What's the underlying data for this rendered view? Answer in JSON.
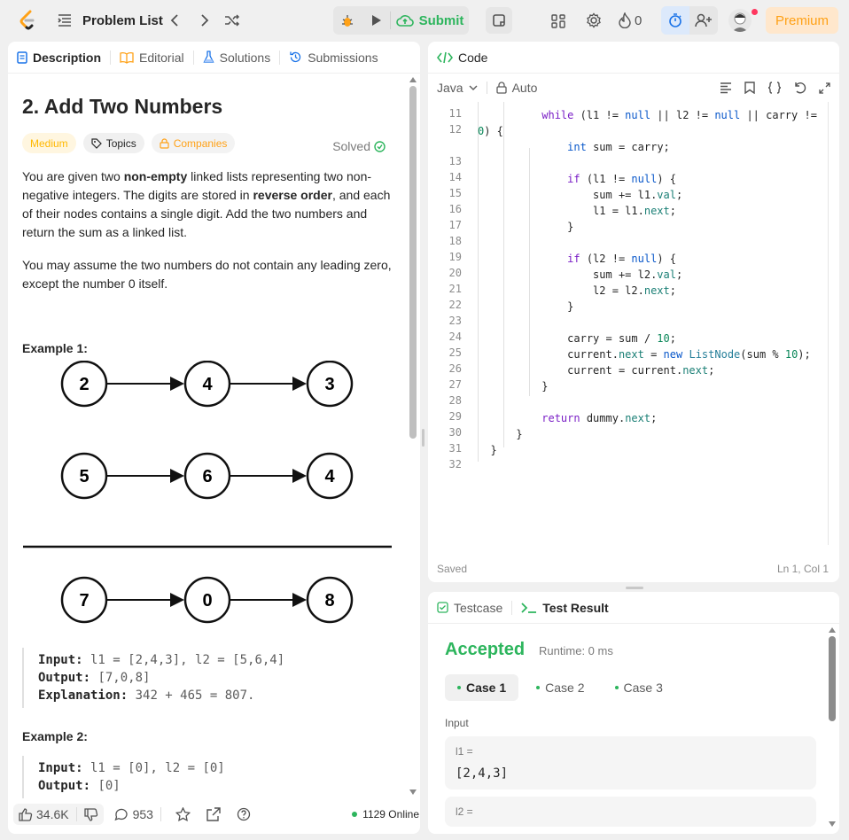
{
  "topbar": {
    "title": "Problem List",
    "submit_label": "Submit",
    "streak_count": "0",
    "premium_label": "Premium"
  },
  "left_tabs": [
    {
      "label": "Description"
    },
    {
      "label": "Editorial"
    },
    {
      "label": "Solutions"
    },
    {
      "label": "Submissions"
    }
  ],
  "problem": {
    "title": "2. Add Two Numbers",
    "status": "Solved",
    "difficulty": "Medium",
    "topics_label": "Topics",
    "companies_label": "Companies",
    "p1_a": "You are given two ",
    "p1_b": "non-empty",
    "p1_c": " linked lists representing two non-negative integers. The digits are stored in ",
    "p1_d": "reverse order",
    "p1_e": ", and each of their nodes contains a single digit. Add the two numbers and return the sum as a linked list.",
    "p2": "You may assume the two numbers do not contain any leading zero, except the number 0 itself.",
    "example1_title": "Example 1:",
    "diagram": {
      "row1": [
        "2",
        "4",
        "3"
      ],
      "row2": [
        "5",
        "6",
        "4"
      ],
      "row3": [
        "7",
        "0",
        "8"
      ]
    },
    "ex1_input_label": "Input:",
    "ex1_input": " l1 = [2,4,3], l2 = [5,6,4]",
    "ex1_output_label": "Output:",
    "ex1_output": " [7,0,8]",
    "ex1_expl_label": "Explanation:",
    "ex1_expl": " 342 + 465 = 807.",
    "example2_title": "Example 2:",
    "ex2_input_label": "Input:",
    "ex2_input": " l1 = [0], l2 = [0]",
    "ex2_output_label": "Output:",
    "ex2_output": " [0]"
  },
  "footer": {
    "likes": "34.6K",
    "comments": "953",
    "online": "1129 Online"
  },
  "code_panel": {
    "title": "Code",
    "language": "Java",
    "mode": "Auto",
    "status_saved": "Saved",
    "cursor": "Ln 1, Col 1",
    "line_numbers": [
      "11",
      "12",
      "",
      "13",
      "14",
      "15",
      "16",
      "17",
      "18",
      "19",
      "20",
      "21",
      "22",
      "23",
      "24",
      "25",
      "26",
      "27",
      "28",
      "29",
      "30",
      "31",
      "32"
    ]
  },
  "result_panel": {
    "testcase_tab": "Testcase",
    "result_tab": "Test Result",
    "verdict": "Accepted",
    "runtime": "Runtime: 0 ms",
    "cases": [
      "Case 1",
      "Case 2",
      "Case 3"
    ],
    "input_label": "Input",
    "l1_label": "l1 =",
    "l1_value": "[2,4,3]",
    "l2_label": "l2 ="
  }
}
